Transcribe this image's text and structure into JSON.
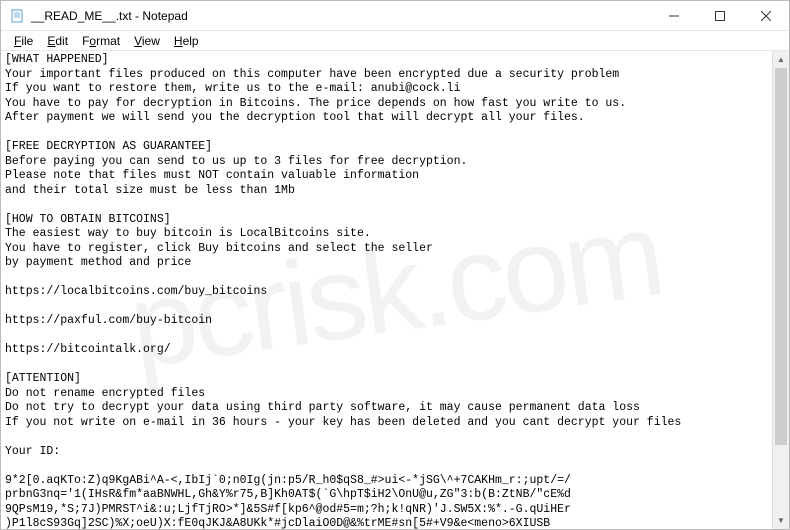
{
  "titlebar": {
    "title": "__READ_ME__.txt - Notepad"
  },
  "menubar": {
    "file": "File",
    "edit": "Edit",
    "format": "Format",
    "view": "View",
    "help": "Help"
  },
  "document": {
    "lines": [
      "[WHAT HAPPENED]",
      "Your important files produced on this computer have been encrypted due a security problem",
      "If you want to restore them, write us to the e-mail: anubi@cock.li",
      "You have to pay for decryption in Bitcoins. The price depends on how fast you write to us.",
      "After payment we will send you the decryption tool that will decrypt all your files.",
      "",
      "[FREE DECRYPTION AS GUARANTEE]",
      "Before paying you can send to us up to 3 files for free decryption.",
      "Please note that files must NOT contain valuable information",
      "and their total size must be less than 1Mb",
      "",
      "[HOW TO OBTAIN BITCOINS]",
      "The easiest way to buy bitcoin is LocalBitcoins site.",
      "You have to register, click Buy bitcoins and select the seller",
      "by payment method and price",
      "",
      "https://localbitcoins.com/buy_bitcoins",
      "",
      "https://paxful.com/buy-bitcoin",
      "",
      "https://bitcointalk.org/",
      "",
      "[ATTENTION]",
      "Do not rename encrypted files",
      "Do not try to decrypt your data using third party software, it may cause permanent data loss",
      "If you not write on e-mail in 36 hours - your key has been deleted and you cant decrypt your files",
      "",
      "Your ID:",
      "",
      "9*2[0.aqKTo:Z)q9KgABi^A-<,IbIj`0;n0Ig(jn:p5/R_h0$qS8_#>ui<-*jSG\\^+7CAKHm_r:;upt/=/",
      "prbnG3nq='1(IHsR&fm*aaBNWHL,Gh&Y%r75,B]Kh0AT$(`G\\hpT$iH2\\OnU@u,ZG\"3:b(B:ZtNB/\"cE%d",
      "9QPsM19,*S;7J)PMRST^i&:u;LjfTjRO>*]&5S#f[kp6^@od#5=m;?h;k!qNR)'J.SW5X:%*.-G.qUiHEr",
      ")P1l8cS93Gq]2SC)%X;oeU)X:fE0qJKJ&A8UKk*#jcDlaiO0D@&%trME#sn[5#+V9&e<meno>6XIUSB"
    ]
  },
  "watermark": "pcrisk.com"
}
